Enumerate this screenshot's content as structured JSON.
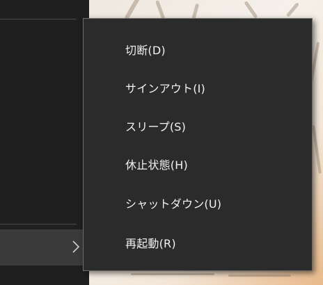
{
  "power_menu": {
    "items": [
      {
        "label": "切断(D)"
      },
      {
        "label": "サインアウト(I)"
      },
      {
        "label": "スリープ(S)"
      },
      {
        "label": "休止状態(H)"
      },
      {
        "label": "シャットダウン(U)"
      },
      {
        "label": "再起動(R)"
      }
    ]
  },
  "colors": {
    "menu_background": "#2b2b2b",
    "menu_border": "#6e6e6e",
    "menu_text": "#f2f2f2",
    "start_panel": "#1f1f1f",
    "power_row_highlight": "#3a3a3a"
  },
  "icons": {
    "power_submenu_indicator": "chevron-right-icon"
  }
}
